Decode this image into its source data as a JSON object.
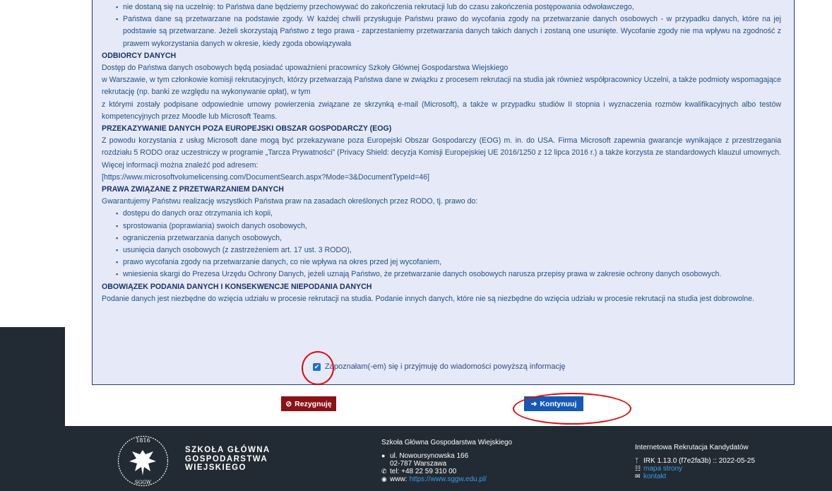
{
  "policy": {
    "bullets_top": [
      "nie dostaną się na uczelnię: to Państwa dane będziemy przechowywać do zakończenia rekrutacji lub do czasu zakończenia postępowania odwoławczego,",
      "Państwa dane są przetwarzane na podstawie zgody. W każdej chwili przysługuje Państwu prawo do wycofania zgody na przetwarzanie danych osobowych - w przypadku danych, które na jej podstawie są przetwarzane. Jeżeli skorzystają Państwo z tego prawa - zaprzestaniemy przetwarzania danych takich danych i zostaną one usunięte. Wycofanie zgody nie ma wpływu na zgodność z prawem wykorzystania danych w okresie, kiedy zgoda obowiązywała"
    ],
    "recipients_title": "ODBIORCY DANYCH",
    "recipients_lines": [
      "Dostęp do Państwa danych osobowych będą posiadać upoważnieni pracownicy Szkoły Głównej Gospodarstwa Wiejskiego",
      "w Warszawie, w tym członkowie komisji rekrutacyjnych, którzy przetwarzają Państwa dane w związku z procesem rekrutacji na studia jak również współpracownicy Uczelni, a także podmioty wspomagające rekrutację (np. banki ze względu na wykonywanie opłat), w tym",
      "z którymi zostały podpisane odpowiednie umowy powierzenia związane ze skrzynką e-mail (Microsoft), a także w przypadku studiów II stopnia i wyznaczenia rozmów kwalifikacyjnych albo testów kompetencyjnych przez Moodle lub Microsoft Teams."
    ],
    "transfer_title": "PRZEKAZYWANIE DANYCH POZA EUROPEJSKI OBSZAR GOSPODARCZY (EOG)",
    "transfer_text": "Z powodu korzystania z usług Microsoft dane mogą być przekazywane poza Europejski Obszar Gospodarczy (EOG) m. in. do USA. Firma Microsoft zapewnia gwarancje wynikające z przestrzegania rozdziału 5 RODO oraz uczestniczy w programie „Tarcza Prywatności” (Privacy Shield: decyzja Komisji Europejskiej UE 2016/1250 z 12 lipca 2016 r.) a także korzysta ze standardowych klauzul umownych. Więcej informacji można znaleźć pod adresem:",
    "transfer_link": "[https://www.microsoftvolumelicensing.com/DocumentSearch.aspx?Mode=3&DocumentTypeId=46]",
    "rights_title": "PRAWA ZWIĄZANE Z PRZETWARZANIEM DANYCH",
    "rights_intro": "Gwarantujemy Państwu realizację wszystkich Państwa praw na zasadach określonych przez RODO, tj. prawo do:",
    "rights": [
      "dostępu do danych oraz otrzymania ich kopii,",
      "sprostowania (poprawiania) swoich danych osobowych,",
      "ograniczenia przetwarzania danych osobowych,",
      "usunięcia danych osobowych (z zastrzeżeniem art. 17 ust. 3 RODO),",
      "prawo wycofania zgody na przetwarzanie danych, co nie wpływa na okres przed jej wycofaniem,",
      "wniesienia skargi do Prezesa Urzędu Ochrony Danych, jeżeli uznają Państwo, że przetwarzanie danych osobowych narusza przepisy prawa w zakresie ochrony danych osobowych."
    ],
    "obligation_title": "OBOWIĄZEK PODANIA DANYCH I KONSEKWENCJE NIEPODANIA DANYCH",
    "obligation_text": "Podanie danych jest niezbędne do wzięcia udziału w procesie rekrutacji na studia. Podanie innych danych, które nie są niezbędne do wzięcia udziału w procesie rekrutacji na studia jest dobrowolne."
  },
  "consent": {
    "label": "Zapoznałam(-em) się i przyjmuję do wiadomości powyższą informację",
    "checked": true
  },
  "buttons": {
    "cancel": "Rezygnuję",
    "continue": "Kontynuuj"
  },
  "footer": {
    "logo_year": "1816",
    "logo_letters": "SGGW",
    "logo_lines": [
      "SZKOŁA GŁÓWNA",
      "GOSPODARSTWA",
      "WIEJSKIEGO"
    ],
    "org_title": "Szkoła Główna Gospodarstwa Wiejskiego",
    "address_line1": "ul. Nowoursynowska 166",
    "address_line2": "02-787 Warszawa",
    "phone": "tel: +48 22 59 310 00",
    "www_label": "www:",
    "www_url": "https://www.sggw.edu.pl/",
    "app_title": "Internetowa Rekrutacja Kandydatów",
    "version": "IRK 1.13.0 (f7e2fa3b) :: 2022-05-25",
    "sitemap": "mapa strony",
    "contact": "kontakt"
  },
  "colors": {
    "panel_bg": "#e6eaf8",
    "footer_bg": "#222b33",
    "cancel": "#8a1216",
    "continue": "#1559b5",
    "highlight": "#e00a0a"
  }
}
